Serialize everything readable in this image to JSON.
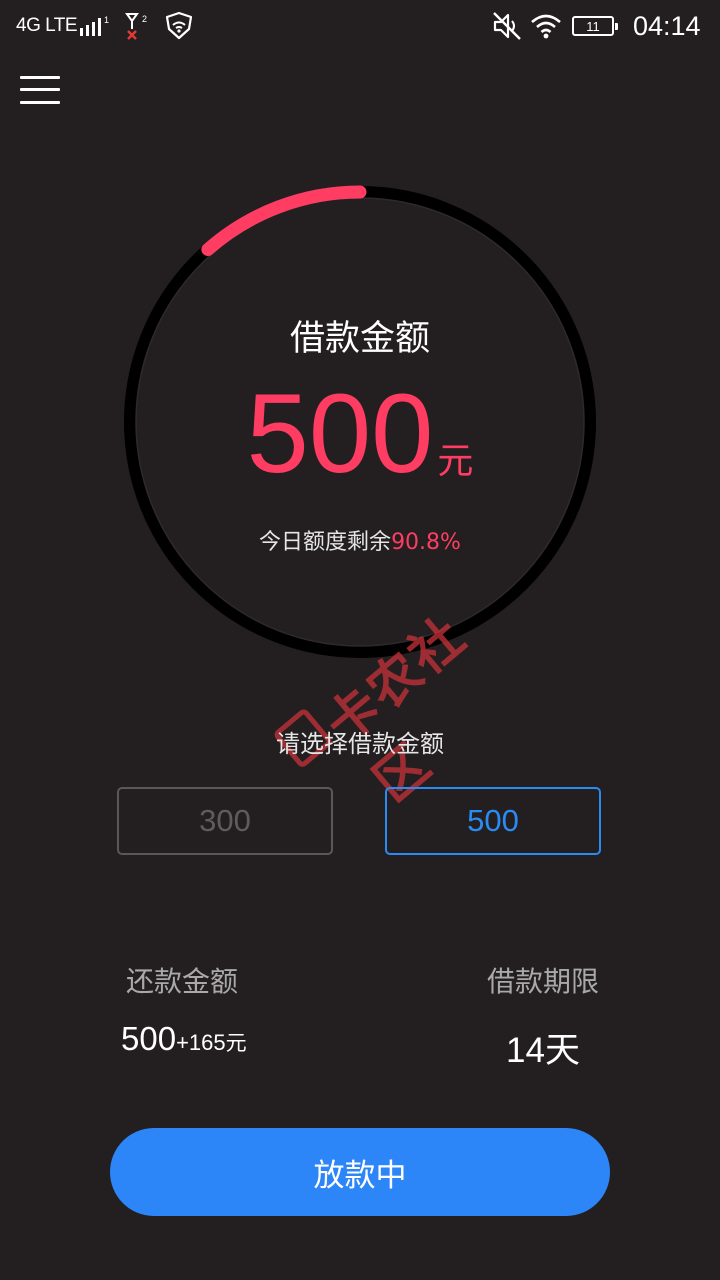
{
  "status_bar": {
    "network_label": "4G LTE",
    "sim2_label": "2",
    "battery_level": "11",
    "time": "04:14",
    "icons": [
      "signal-bars-icon",
      "sim2-no-signal-icon",
      "shield-wifi-icon",
      "mute-icon",
      "wifi-icon",
      "battery-icon"
    ]
  },
  "header": {
    "menu_icon": "hamburger-menu-icon"
  },
  "gauge": {
    "title": "借款金额",
    "amount": "500",
    "unit": "元",
    "remaining_prefix": "今日额度剩余",
    "remaining_percent": "90.8%",
    "used_fraction": 0.092,
    "track_color": "#000000",
    "arc_color": "#ff3d63"
  },
  "watermark": {
    "text": "卡农社区"
  },
  "selector": {
    "label": "请选择借款金额",
    "options": [
      {
        "label": "300",
        "selected": false
      },
      {
        "label": "500",
        "selected": true
      }
    ]
  },
  "summary": {
    "repay_label": "还款金额",
    "repay_principal": "500",
    "repay_extra": "+165",
    "repay_unit": "元",
    "term_label": "借款期限",
    "term_value": "14",
    "term_unit": "天"
  },
  "action": {
    "button_label": "放款中"
  },
  "colors": {
    "background": "#231f20",
    "accent_red": "#ff3d63",
    "accent_blue": "#2c86f8",
    "selected_border": "#2a8bf2"
  }
}
